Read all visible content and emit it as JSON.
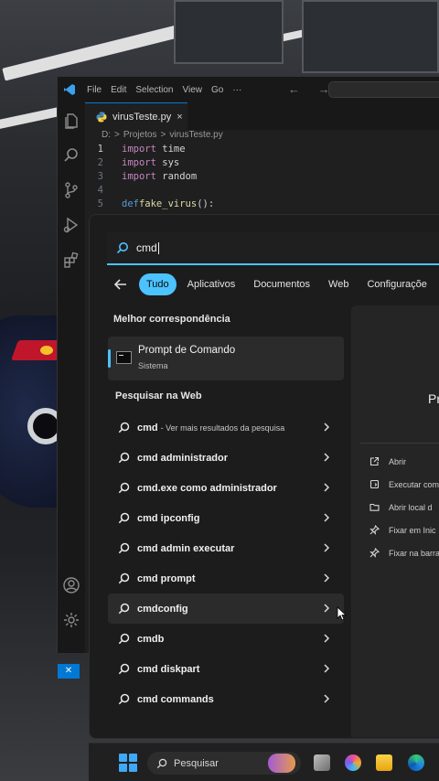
{
  "vscode": {
    "menu": [
      "File",
      "Edit",
      "Selection",
      "View",
      "Go",
      "···"
    ],
    "nav_arrows": "← →",
    "tab": {
      "label": "virusTeste.py",
      "close": "×"
    },
    "breadcrumb": [
      "D:",
      ">",
      "Projetos",
      ">",
      "virusTeste.py"
    ],
    "code": [
      {
        "n": "1",
        "kw": "import",
        "rest": " time"
      },
      {
        "n": "2",
        "kw": "import",
        "rest": " sys"
      },
      {
        "n": "3",
        "kw": "import",
        "rest": " random"
      },
      {
        "n": "4",
        "kw": "",
        "rest": ""
      },
      {
        "n": "5",
        "kw": "def",
        "fn": " fake_virus",
        "rest": "():"
      }
    ],
    "remote_label": "✕"
  },
  "search": {
    "query": "cmd",
    "filters": [
      "Tudo",
      "Aplicativos",
      "Documentos",
      "Web",
      "Configuraçõe"
    ],
    "active_filter": "Tudo",
    "best_match_heading": "Melhor correspondência",
    "best_match": {
      "name": "Prompt de Comando",
      "type": "Sistema"
    },
    "web_heading": "Pesquisar na Web",
    "web_results": [
      {
        "bold": "cmd",
        "rest": "",
        "sub": "- Ver mais resultados da pesquisa"
      },
      {
        "bold": "cmd",
        "rest": " administrador",
        "sub": ""
      },
      {
        "bold": "cmd",
        "rest": ".exe como administrador",
        "sub": ""
      },
      {
        "bold": "cmd",
        "rest": " ipconfig",
        "sub": ""
      },
      {
        "bold": "cmd",
        "rest": " admin executar",
        "sub": ""
      },
      {
        "bold": "cmd",
        "rest": " prompt",
        "sub": ""
      },
      {
        "bold": "cmd",
        "rest": "config",
        "sub": ""
      },
      {
        "bold": "cmd",
        "rest": "b",
        "sub": ""
      },
      {
        "bold": "cmd",
        "rest": " diskpart",
        "sub": ""
      },
      {
        "bold": "cmd",
        "rest": " commands",
        "sub": ""
      }
    ],
    "hovered_result": 6,
    "detail": {
      "title": "Pr",
      "actions": [
        {
          "icon": "open-icon",
          "label": "Abrir"
        },
        {
          "icon": "shield-run-icon",
          "label": "Executar com"
        },
        {
          "icon": "folder-icon",
          "label": "Abrir local d"
        },
        {
          "icon": "pin-icon",
          "label": "Fixar em Inic"
        },
        {
          "icon": "pin-icon",
          "label": "Fixar na barra"
        }
      ]
    }
  },
  "taskbar": {
    "search_placeholder": "Pesquisar"
  },
  "colors": {
    "accent": "#4cc2ff",
    "vscode_blue": "#0078d4",
    "windows_blue": "#3fa9f5"
  }
}
